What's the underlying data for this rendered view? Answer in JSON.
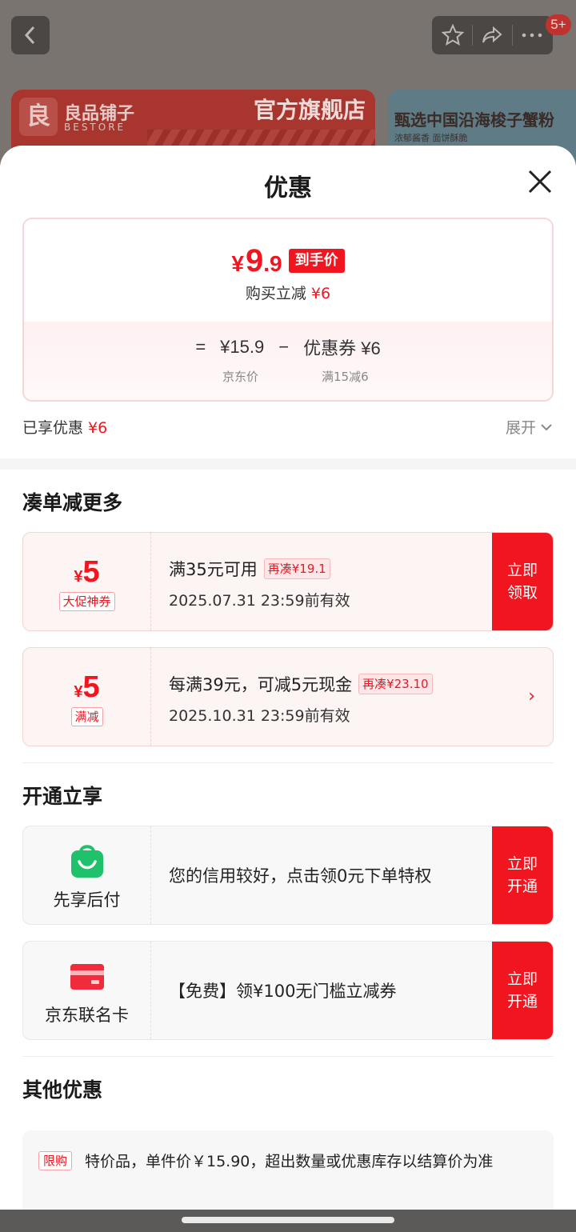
{
  "background": {
    "badge": "5+",
    "banner1": {
      "brand": "良品铺子",
      "brand_en": "BESTORE",
      "store": "官方旗舰店"
    },
    "banner2": {
      "title": "甄选中国沿海梭子蟹粉",
      "sub": "浓郁酱香 面饼酥脆"
    }
  },
  "sheet": {
    "title": "优惠",
    "final": {
      "currency": "¥",
      "int": "9",
      "dec": ".9",
      "tag": "到手价"
    },
    "instant": {
      "label": "购买立减",
      "value": "¥6"
    },
    "calc": {
      "eq": "=",
      "base": "¥15.9",
      "minus": "−",
      "coupon": "优惠券 ¥6",
      "base_label": "京东价",
      "coupon_label": "满15减6"
    },
    "enjoyed": {
      "label": "已享优惠",
      "value": "¥6",
      "expand": "展开"
    }
  },
  "more": {
    "title": "凑单减更多",
    "coupons": [
      {
        "currency": "¥",
        "amount": "5",
        "tag": "大促神券",
        "cond": "满35元可用",
        "extra": "再凑¥19.1",
        "valid": "2025.07.31 23:59前有效",
        "action": "立即领取"
      },
      {
        "currency": "¥",
        "amount": "5",
        "tag": "满减",
        "cond": "每满39元，可减5元现金",
        "extra": "再凑¥23.10",
        "valid": "2025.10.31 23:59前有效",
        "action": "›"
      }
    ]
  },
  "open": {
    "title": "开通立享",
    "items": [
      {
        "name": "先享后付",
        "desc": "您的信用较好，点击领0元下单特权",
        "action": "立即开通",
        "icon": "bag-icon"
      },
      {
        "name": "京东联名卡",
        "desc": "【免费】领¥100无门槛立减券",
        "action": "立即开通",
        "icon": "card-icon"
      }
    ]
  },
  "other": {
    "title": "其他优惠",
    "tag": "限购",
    "text": "特价品，单件价￥15.90，超出数量或优惠库存以结算价为准"
  },
  "colors": {
    "accent": "#f0151f",
    "coupon_bg": "#fdf4f4"
  }
}
